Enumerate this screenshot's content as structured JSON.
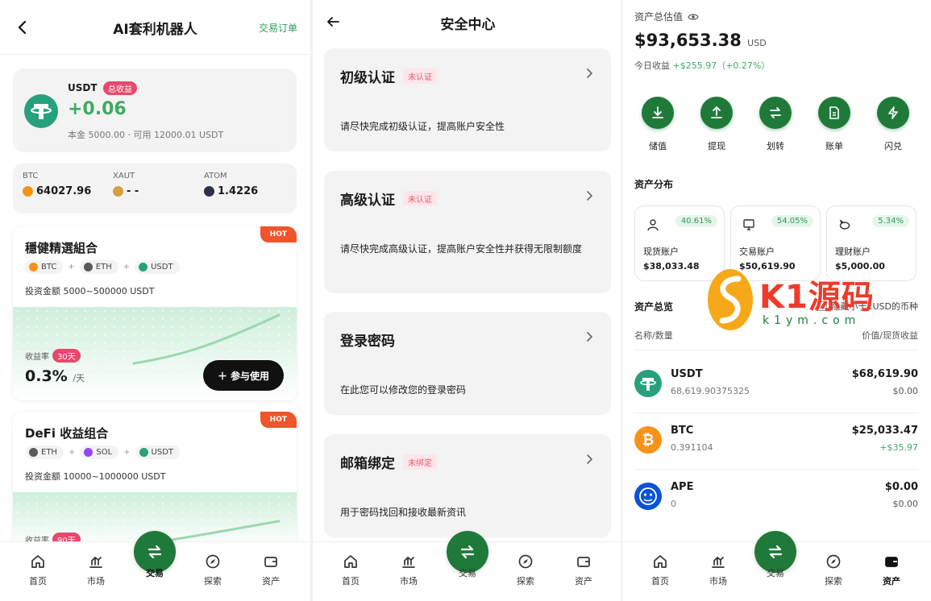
{
  "panel1": {
    "title": "AI套利机器人",
    "orders_link": "交易订单",
    "usdt_card": {
      "coin": "USDT",
      "badge": "总收益",
      "profit": "+0.06",
      "sub": "本金 5000.00 · 可用 12000.01 USDT"
    },
    "tickers": [
      {
        "name": "BTC",
        "price": "64027.96",
        "color": "#f7931a"
      },
      {
        "name": "XAUT",
        "price": "- -",
        "color": "#d4a13a"
      },
      {
        "name": "ATOM",
        "price": "1.4226",
        "color": "#2e3148"
      }
    ],
    "combos": [
      {
        "tag": "HOT",
        "title": "穩健精選組合",
        "coins": [
          {
            "name": "BTC",
            "color": "#f7931a"
          },
          {
            "name": "ETH",
            "color": "#5a5a5a"
          },
          {
            "name": "USDT",
            "color": "#26a17b"
          }
        ],
        "amount": "投资金额 5000~500000 USDT",
        "rate_label": "收益率",
        "period": "30天",
        "rate": "0.3%",
        "rate_unit": "/天",
        "join": "参与使用"
      },
      {
        "tag": "HOT",
        "title": "DeFi 收益组合",
        "coins": [
          {
            "name": "ETH",
            "color": "#5a5a5a"
          },
          {
            "name": "SOL",
            "color": "#9945ff"
          },
          {
            "name": "USDT",
            "color": "#26a17b"
          }
        ],
        "amount": "投资金额 10000~1000000 USDT",
        "rate_label": "收益率",
        "period": "90天"
      }
    ]
  },
  "nav": {
    "items": [
      "首页",
      "市场",
      "交易",
      "探索",
      "资产"
    ]
  },
  "panel2": {
    "title": "安全中心",
    "cards": [
      {
        "title": "初级认证",
        "badge": "未认证",
        "desc": "请尽快完成初级认证，提高账户安全性"
      },
      {
        "title": "高级认证",
        "badge": "未认证",
        "desc": "请尽快完成高级认证，提高账户安全性并获得无限制额度"
      },
      {
        "title": "登录密码",
        "badge": "",
        "desc": "在此您可以修改您的登录密码"
      },
      {
        "title": "邮箱绑定",
        "badge": "未绑定",
        "desc": "用于密码找回和接收最新资讯"
      }
    ]
  },
  "panel3": {
    "label": "资产总估值",
    "total": "$93,653.38",
    "total_unit": "USD",
    "today_label": "今日收益",
    "today_value": "+$255.97（+0.27%）",
    "actions": [
      "储值",
      "提现",
      "划转",
      "账单",
      "闪兑"
    ],
    "dist_title": "资产分布",
    "distribution": [
      {
        "name": "现货账户",
        "pct": "40.61%",
        "value": "$38,033.48"
      },
      {
        "name": "交易账户",
        "pct": "54.05%",
        "value": "$50,619.90"
      },
      {
        "name": "理财账户",
        "pct": "5.34%",
        "value": "$5,000.00"
      }
    ],
    "overview_title": "资产总览",
    "hide_small": "隐藏小于1USD的币种",
    "col_left": "名称/数量",
    "col_right": "价值/现货收益",
    "assets": [
      {
        "name": "USDT",
        "qty": "68,619.90375325",
        "value": "$68,619.90",
        "pnl": "$0.00",
        "color": "#26a17b",
        "positive": false
      },
      {
        "name": "BTC",
        "qty": "0.391104",
        "value": "$25,033.47",
        "pnl": "+$35.97",
        "color": "#f7931a",
        "positive": true
      },
      {
        "name": "APE",
        "qty": "0",
        "value": "$0.00",
        "pnl": "$0.00",
        "color": "#0b52d8",
        "positive": false
      }
    ]
  },
  "watermark": {
    "text": "K1源码",
    "sub": "k1ym.com"
  },
  "colors": {
    "brand_green": "#1f7a3a",
    "profit_green": "#3dab63",
    "hot_orange": "#f0542b",
    "badge_red": "#e8486b"
  }
}
